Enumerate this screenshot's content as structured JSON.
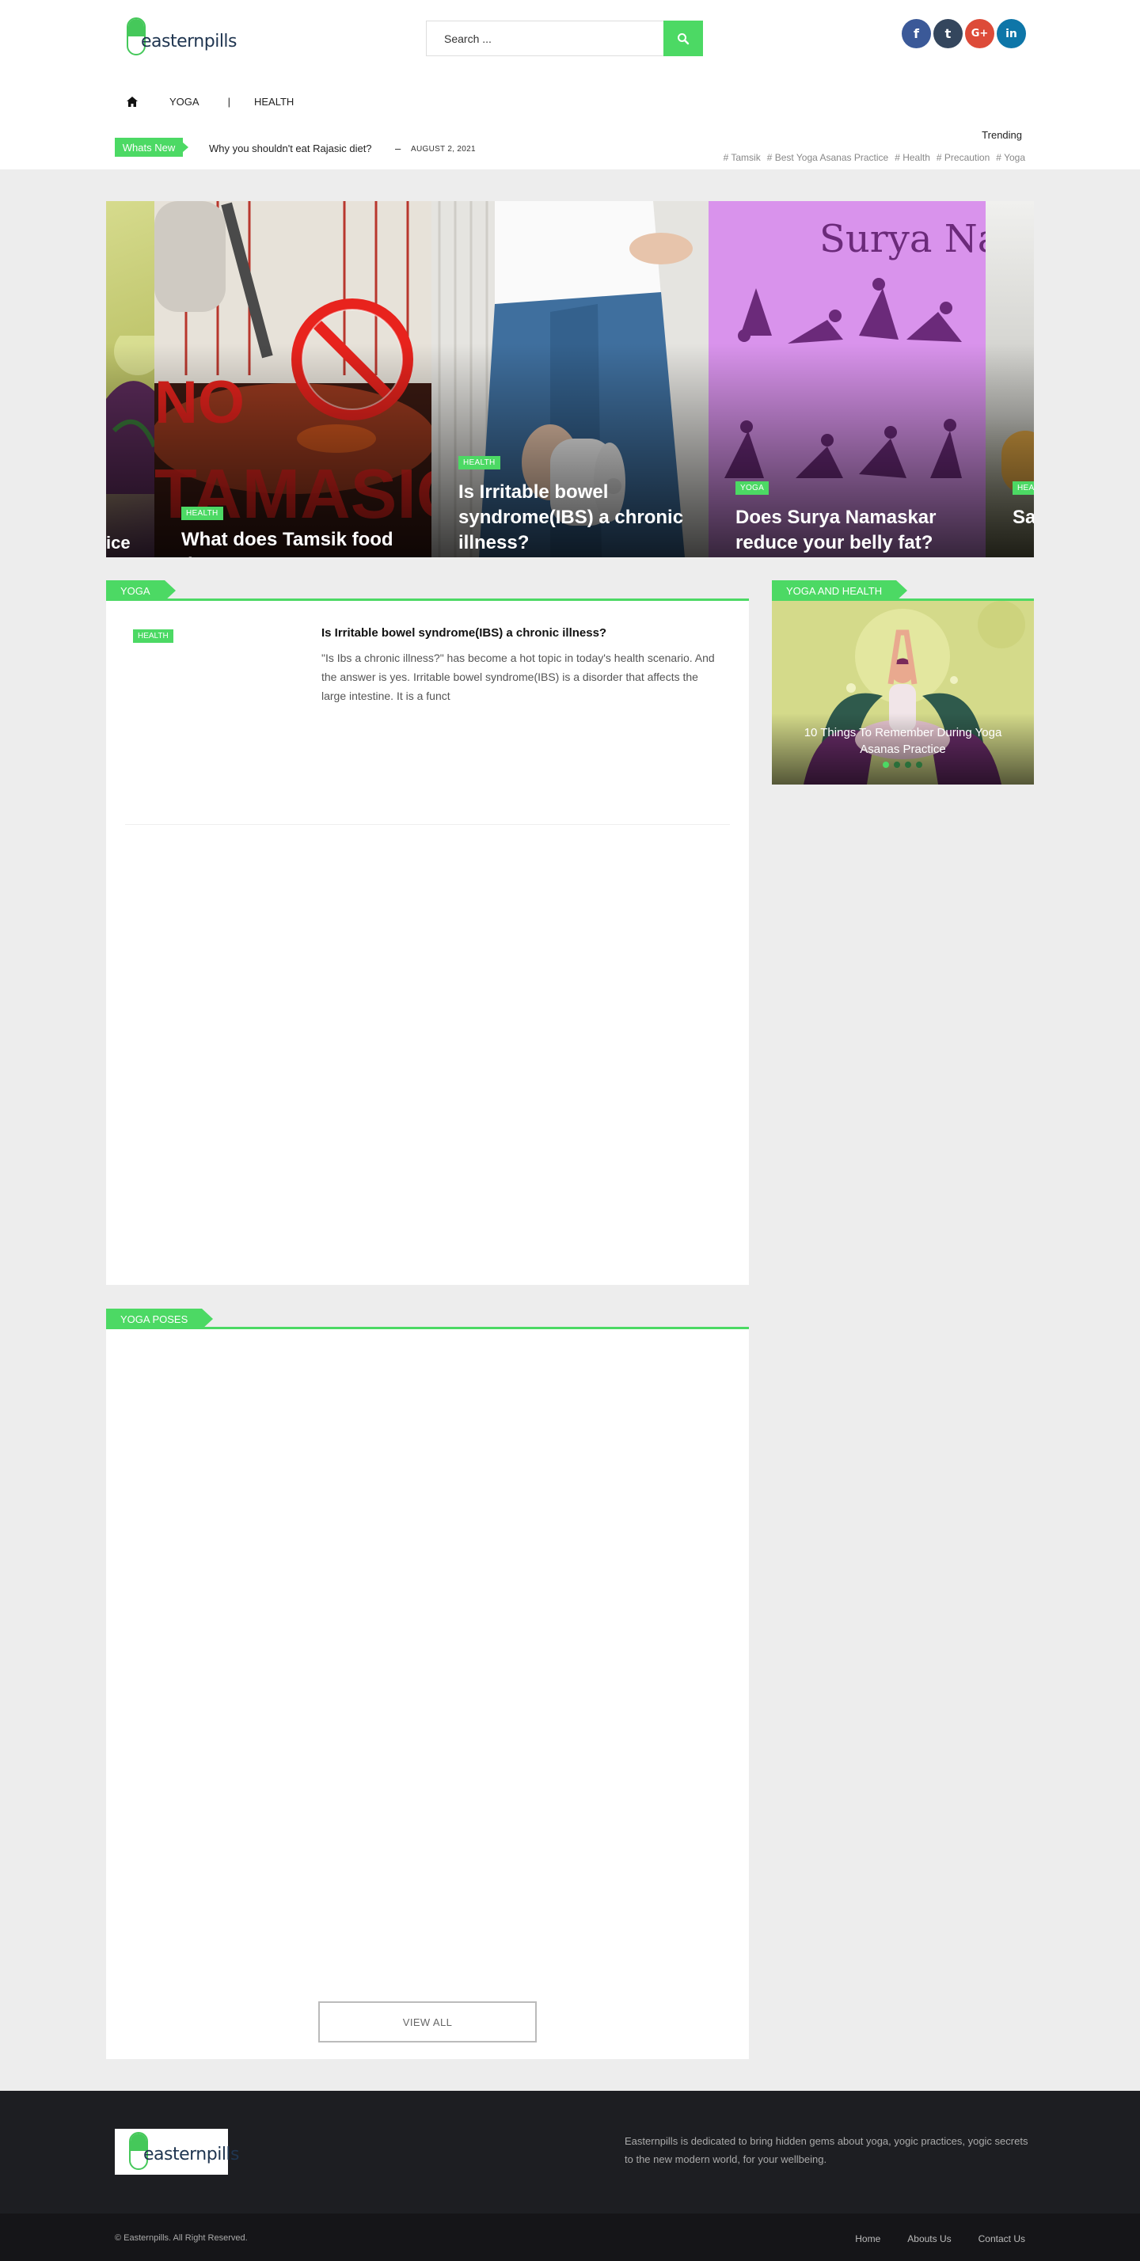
{
  "brand": {
    "name": "easternpills"
  },
  "search": {
    "placeholder": "Search ..."
  },
  "social": [
    {
      "icon": "facebook-icon",
      "glyph": "f",
      "color": "#3b5998"
    },
    {
      "icon": "tumblr-icon",
      "glyph": "t",
      "color": "#34465d"
    },
    {
      "icon": "google-plus-icon",
      "glyph": "G+",
      "color": "#dd4b39"
    },
    {
      "icon": "linkedin-icon",
      "glyph": "in",
      "color": "#0e76a8"
    }
  ],
  "nav": {
    "items": [
      "YOGA",
      "|",
      "HEALTH"
    ]
  },
  "ticker": {
    "badge": "Whats New",
    "title": "Why you shouldn't eat Rajasic diet?",
    "separator": "–",
    "date": "AUGUST 2, 2021"
  },
  "trending": {
    "label": "Trending",
    "tags": [
      "# Tamsik",
      "# Best Yoga Asanas Practice",
      "# Health",
      "# Precaution",
      "# Yoga"
    ]
  },
  "carousel": {
    "slides": [
      {
        "category": "",
        "title": "ice"
      },
      {
        "category": "HEALTH",
        "title": "What does Tamsik food do?"
      },
      {
        "category": "HEALTH",
        "title": "Is Irritable bowel syndrome(IBS) a chronic illness?"
      },
      {
        "category": "YOGA",
        "title": "Does Surya Namaskar reduce your belly fat?"
      },
      {
        "category": "HEA",
        "title": "Sa Im"
      }
    ],
    "slide3_image_text": "Surya Nam"
  },
  "yoga_section": {
    "heading": "YOGA",
    "post": {
      "category": "HEALTH",
      "title": "Is Irritable bowel syndrome(IBS) a chronic illness?",
      "excerpt": "\"Is Ibs a chronic illness?\" has become a hot topic in today's health scenario. And the answer is yes.  Irritable bowel syndrome(IBS) is a disorder that affects the large intestine. It is a funct"
    }
  },
  "poses_section": {
    "heading": "YOGA POSES",
    "view_all": "VIEW ALL"
  },
  "sidebar": {
    "heading": "YOGA AND HEALTH",
    "card_title": "10 Things To Remember During Yoga Asanas Practice",
    "dots": 4,
    "active_dot": 0
  },
  "footer": {
    "about": "Easternpills is dedicated to bring hidden gems about yoga, yogic practices, yogic secrets to the new modern world, for your wellbeing.",
    "copyright": "© Easternpills. All Right Reserved.",
    "links": [
      "Home",
      "Abouts Us",
      "Contact Us"
    ]
  },
  "colors": {
    "accent": "#4cd964",
    "footer_bg": "#1d1e22",
    "page_bg": "#ededed"
  }
}
